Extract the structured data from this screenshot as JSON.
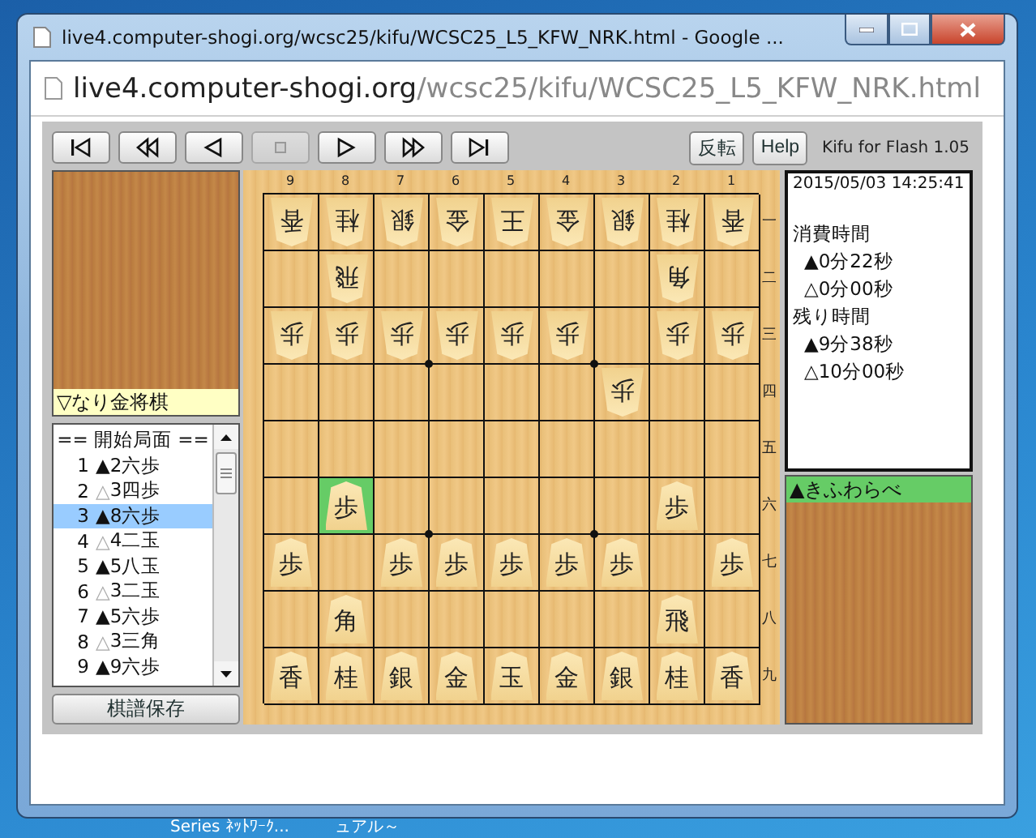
{
  "window": {
    "title": "live4.computer-shogi.org/wcsc25/kifu/WCSC25_L5_KFW_NRK.html - Google ...",
    "url_host": "live4.computer-shogi.org",
    "url_path": "/wcsc25/kifu/WCSC25_L5_KFW_NRK.html"
  },
  "nav_buttons": [
    {
      "kind": "first",
      "disabled": false
    },
    {
      "kind": "rewind",
      "disabled": false
    },
    {
      "kind": "back",
      "disabled": false
    },
    {
      "kind": "stop",
      "disabled": true
    },
    {
      "kind": "forward",
      "disabled": false
    },
    {
      "kind": "fast-forward",
      "disabled": false
    },
    {
      "kind": "last",
      "disabled": false
    }
  ],
  "text_buttons": [
    "反転",
    "Help"
  ],
  "version": "Kifu for Flash 1.05",
  "gote_player": {
    "name": "▽なり金将棋",
    "active": false
  },
  "moves": {
    "header": "== 開始局面 ==",
    "items": [
      {
        "number": "1",
        "mark": "▲",
        "move": "2六歩",
        "kind": "sente",
        "selected": false
      },
      {
        "number": "2",
        "mark": "△",
        "move": "3四歩",
        "kind": "gote",
        "selected": false
      },
      {
        "number": "3",
        "mark": "▲",
        "move": "8六歩",
        "kind": "sente",
        "selected": true
      },
      {
        "number": "4",
        "mark": "△",
        "move": "4二玉",
        "kind": "gote",
        "selected": false
      },
      {
        "number": "5",
        "mark": "▲",
        "move": "5八玉",
        "kind": "sente",
        "selected": false
      },
      {
        "number": "6",
        "mark": "△",
        "move": "3二玉",
        "kind": "gote",
        "selected": false
      },
      {
        "number": "7",
        "mark": "▲",
        "move": "5六歩",
        "kind": "sente",
        "selected": false
      },
      {
        "number": "8",
        "mark": "△",
        "move": "3三角",
        "kind": "gote",
        "selected": false
      },
      {
        "number": "9",
        "mark": "▲",
        "move": "9六歩",
        "kind": "sente",
        "selected": false
      }
    ]
  },
  "save_button": "棋譜保存",
  "board": {
    "files": [
      "9",
      "8",
      "7",
      "6",
      "5",
      "4",
      "3",
      "2",
      "1"
    ],
    "ranks": [
      {
        "label": "一",
        "cells": [
          {
            "piece": "香",
            "kind": "gote",
            "highlighted": false
          },
          {
            "piece": "桂",
            "kind": "gote",
            "highlighted": false
          },
          {
            "piece": "銀",
            "kind": "gote",
            "highlighted": false
          },
          {
            "piece": "金",
            "kind": "gote",
            "highlighted": false
          },
          {
            "piece": "王",
            "kind": "gote",
            "highlighted": false
          },
          {
            "piece": "金",
            "kind": "gote",
            "highlighted": false
          },
          {
            "piece": "銀",
            "kind": "gote",
            "highlighted": false
          },
          {
            "piece": "桂",
            "kind": "gote",
            "highlighted": false
          },
          {
            "piece": "香",
            "kind": "gote",
            "highlighted": false
          }
        ]
      },
      {
        "label": "二",
        "cells": [
          {
            "highlighted": false
          },
          {
            "piece": "飛",
            "kind": "gote",
            "highlighted": false
          },
          {
            "highlighted": false
          },
          {
            "highlighted": false
          },
          {
            "highlighted": false
          },
          {
            "highlighted": false
          },
          {
            "highlighted": false
          },
          {
            "piece": "角",
            "kind": "gote",
            "highlighted": false
          },
          {
            "highlighted": false
          }
        ]
      },
      {
        "label": "三",
        "cells": [
          {
            "piece": "歩",
            "kind": "gote",
            "highlighted": false
          },
          {
            "piece": "歩",
            "kind": "gote",
            "highlighted": false
          },
          {
            "piece": "歩",
            "kind": "gote",
            "highlighted": false
          },
          {
            "piece": "歩",
            "kind": "gote",
            "highlighted": false
          },
          {
            "piece": "歩",
            "kind": "gote",
            "highlighted": false
          },
          {
            "piece": "歩",
            "kind": "gote",
            "highlighted": false
          },
          {
            "highlighted": false
          },
          {
            "piece": "歩",
            "kind": "gote",
            "highlighted": false
          },
          {
            "piece": "歩",
            "kind": "gote",
            "highlighted": false
          }
        ]
      },
      {
        "label": "四",
        "cells": [
          {
            "highlighted": false
          },
          {
            "highlighted": false
          },
          {
            "highlighted": false
          },
          {
            "highlighted": false
          },
          {
            "highlighted": false
          },
          {
            "highlighted": false
          },
          {
            "piece": "歩",
            "kind": "gote",
            "highlighted": false
          },
          {
            "highlighted": false
          },
          {
            "highlighted": false
          }
        ]
      },
      {
        "label": "五",
        "cells": [
          {
            "highlighted": false
          },
          {
            "highlighted": false
          },
          {
            "highlighted": false
          },
          {
            "highlighted": false
          },
          {
            "highlighted": false
          },
          {
            "highlighted": false
          },
          {
            "highlighted": false
          },
          {
            "highlighted": false
          },
          {
            "highlighted": false
          }
        ]
      },
      {
        "label": "六",
        "cells": [
          {
            "highlighted": false
          },
          {
            "piece": "歩",
            "kind": "sente",
            "highlighted": true
          },
          {
            "highlighted": false
          },
          {
            "highlighted": false
          },
          {
            "highlighted": false
          },
          {
            "highlighted": false
          },
          {
            "highlighted": false
          },
          {
            "piece": "歩",
            "kind": "sente",
            "highlighted": false
          },
          {
            "highlighted": false
          }
        ]
      },
      {
        "label": "七",
        "cells": [
          {
            "piece": "歩",
            "kind": "sente",
            "highlighted": false
          },
          {
            "highlighted": false
          },
          {
            "piece": "歩",
            "kind": "sente",
            "highlighted": false
          },
          {
            "piece": "歩",
            "kind": "sente",
            "highlighted": false
          },
          {
            "piece": "歩",
            "kind": "sente",
            "highlighted": false
          },
          {
            "piece": "歩",
            "kind": "sente",
            "highlighted": false
          },
          {
            "piece": "歩",
            "kind": "sente",
            "highlighted": false
          },
          {
            "highlighted": false
          },
          {
            "piece": "歩",
            "kind": "sente",
            "highlighted": false
          }
        ]
      },
      {
        "label": "八",
        "cells": [
          {
            "highlighted": false
          },
          {
            "piece": "角",
            "kind": "sente",
            "highlighted": false
          },
          {
            "highlighted": false
          },
          {
            "highlighted": false
          },
          {
            "highlighted": false
          },
          {
            "highlighted": false
          },
          {
            "highlighted": false
          },
          {
            "piece": "飛",
            "kind": "sente",
            "highlighted": false
          },
          {
            "highlighted": false
          }
        ]
      },
      {
        "label": "九",
        "cells": [
          {
            "piece": "香",
            "kind": "sente",
            "highlighted": false
          },
          {
            "piece": "桂",
            "kind": "sente",
            "highlighted": false
          },
          {
            "piece": "銀",
            "kind": "sente",
            "highlighted": false
          },
          {
            "piece": "金",
            "kind": "sente",
            "highlighted": false
          },
          {
            "piece": "玉",
            "kind": "sente",
            "highlighted": false
          },
          {
            "piece": "金",
            "kind": "sente",
            "highlighted": false
          },
          {
            "piece": "銀",
            "kind": "sente",
            "highlighted": false
          },
          {
            "piece": "桂",
            "kind": "sente",
            "highlighted": false
          },
          {
            "piece": "香",
            "kind": "sente",
            "highlighted": false
          }
        ]
      }
    ]
  },
  "info": {
    "datetime": "2015/05/03 14:25:41",
    "sections": [
      {
        "heading": "消費時間",
        "lines": [
          "▲0分22秒",
          "△0分00秒"
        ]
      },
      {
        "heading": "残り時間",
        "lines": [
          "▲9分38秒",
          "△10分00秒"
        ]
      }
    ]
  },
  "sente_player": {
    "name": "▲きふわらべ",
    "active": true
  },
  "desktop_labels": [
    "Series ﾈｯﾄﾜｰｸ...",
    "ュアル～"
  ]
}
